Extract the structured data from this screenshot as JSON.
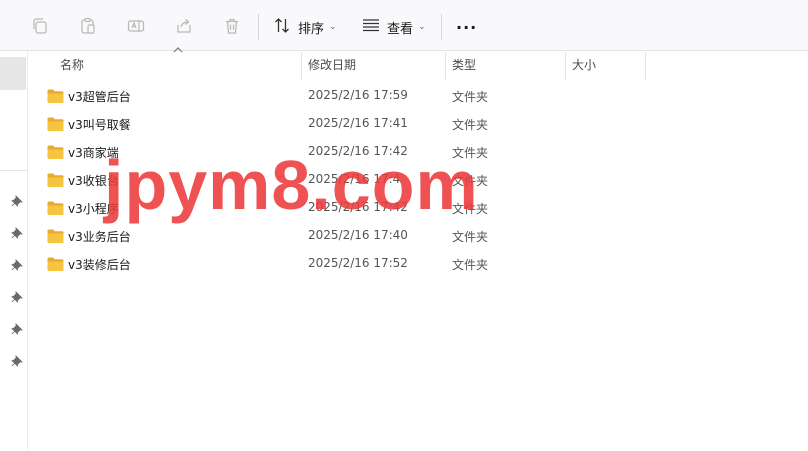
{
  "toolbar": {
    "sort_label": "排序",
    "view_label": "查看",
    "more_label": "···"
  },
  "columns": {
    "name": "名称",
    "date": "修改日期",
    "type": "类型",
    "size": "大小"
  },
  "files": [
    {
      "name": "v3超管后台",
      "date": "2025/2/16 17:59",
      "type": "文件夹"
    },
    {
      "name": "v3叫号取餐",
      "date": "2025/2/16 17:41",
      "type": "文件夹"
    },
    {
      "name": "v3商家端",
      "date": "2025/2/16 17:42",
      "type": "文件夹"
    },
    {
      "name": "v3收银台",
      "date": "2025/2/16 17:4",
      "type": "文件夹"
    },
    {
      "name": "v3小程序",
      "date": "2025/2/16 17:42",
      "type": "文件夹"
    },
    {
      "name": "v3业务后台",
      "date": "2025/2/16 17:40",
      "type": "文件夹"
    },
    {
      "name": "v3装修后台",
      "date": "2025/2/16 17:52",
      "type": "文件夹"
    }
  ],
  "watermark": "jpym8.com",
  "colors": {
    "folder": "#f5c542",
    "watermark": "#ec3b3b",
    "toolbar_bg": "#f9f9fb"
  },
  "icons": [
    "copy-icon",
    "paste-icon",
    "rename-icon",
    "share-icon",
    "delete-icon",
    "sort-icon",
    "view-icon",
    "more-icon",
    "pin-icon",
    "folder-icon"
  ]
}
